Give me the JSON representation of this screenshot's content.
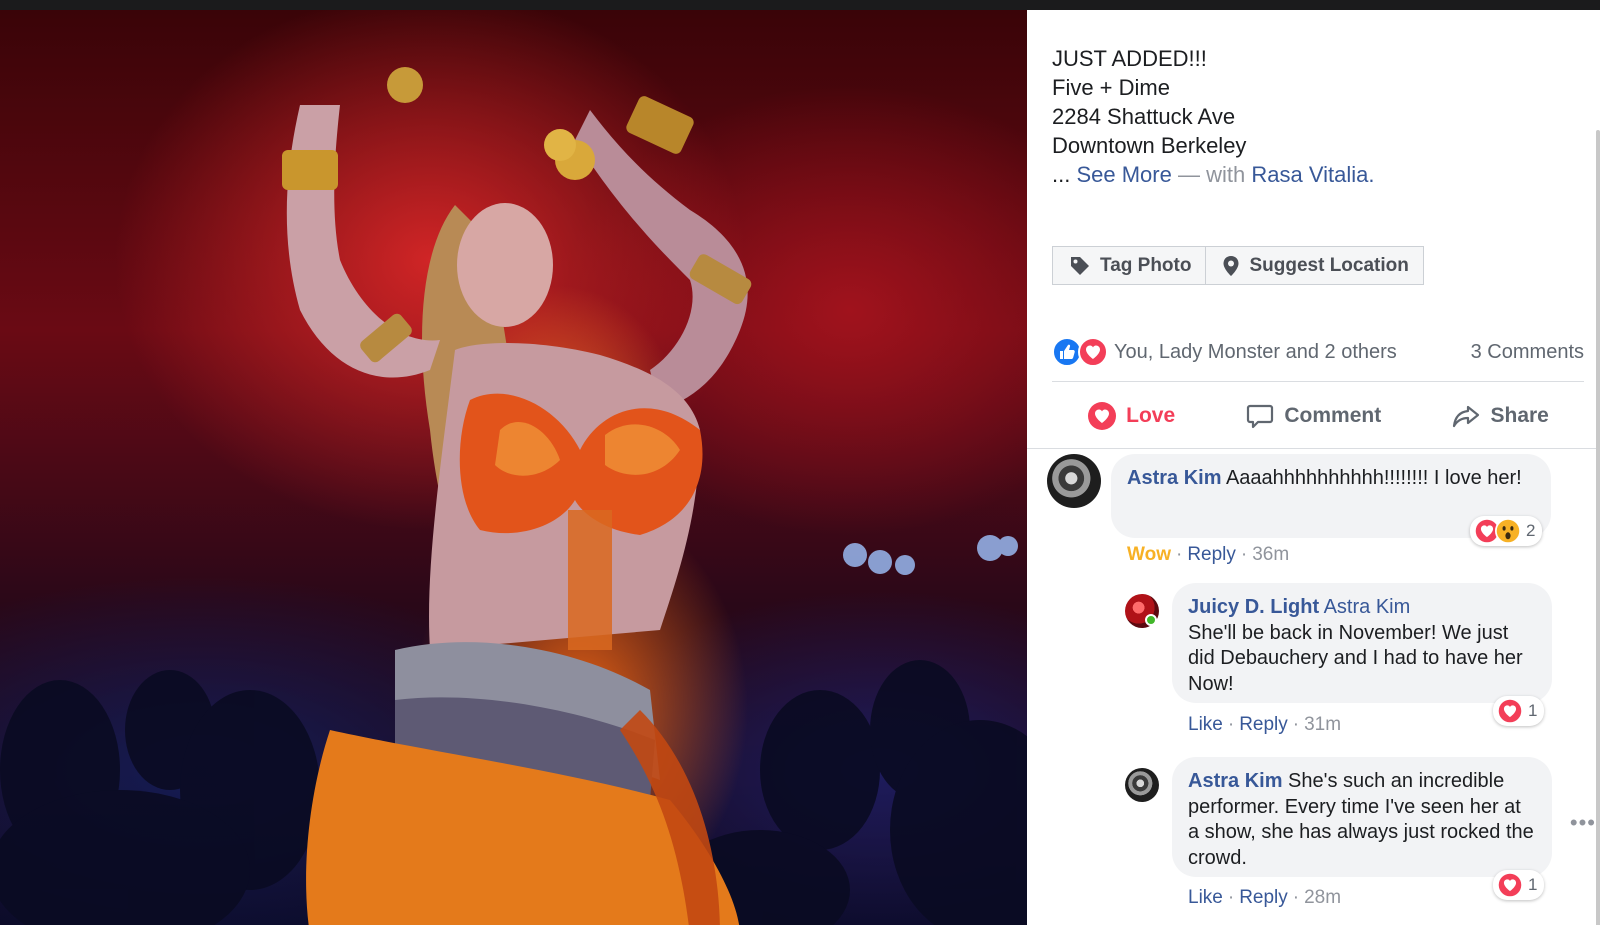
{
  "caption": {
    "line1": "JUST ADDED!!!",
    "line2": "Five + Dime",
    "line3": "2284 Shattuck Ave",
    "line4": "Downtown Berkeley",
    "ellipsis": "...",
    "see_more": "See More",
    "with_text": "— with",
    "tagged": "Rasa Vitalia."
  },
  "photo_actions": {
    "tag_photo": "Tag Photo",
    "suggest_location": "Suggest Location"
  },
  "reactions": {
    "summary": "You, Lady Monster and 2 others",
    "comments_count": "3 Comments"
  },
  "action_bar": {
    "love": "Love",
    "comment": "Comment",
    "share": "Share"
  },
  "comments": [
    {
      "author": "Astra Kim",
      "text": "Aaaahhhhhhhhhh!!!!!!!! I love her!",
      "reaction_label": "Wow",
      "reply": "Reply",
      "time": "36m",
      "reaction_count": "2"
    },
    {
      "author": "Juicy D. Light",
      "mention": "Astra Kim",
      "text": "She'll be back in November! We just did Debauchery and I had to have her Now!",
      "like": "Like",
      "reply": "Reply",
      "time": "31m",
      "reaction_count": "1"
    },
    {
      "author": "Astra Kim",
      "text": "She's such an incredible performer. Every time I've seen her at a show, she has always just rocked the crowd.",
      "like": "Like",
      "reply": "Reply",
      "time": "28m",
      "reaction_count": "1"
    }
  ],
  "colors": {
    "link": "#385898",
    "love": "#f33e58",
    "like_blue": "#1877f2",
    "wow": "#f7b125"
  },
  "icons": [
    "tag-icon",
    "location-pin-icon",
    "like-reaction-icon",
    "love-reaction-icon",
    "wow-reaction-icon",
    "heart-icon",
    "comment-bubble-icon",
    "share-arrow-icon",
    "more-options-icon"
  ]
}
